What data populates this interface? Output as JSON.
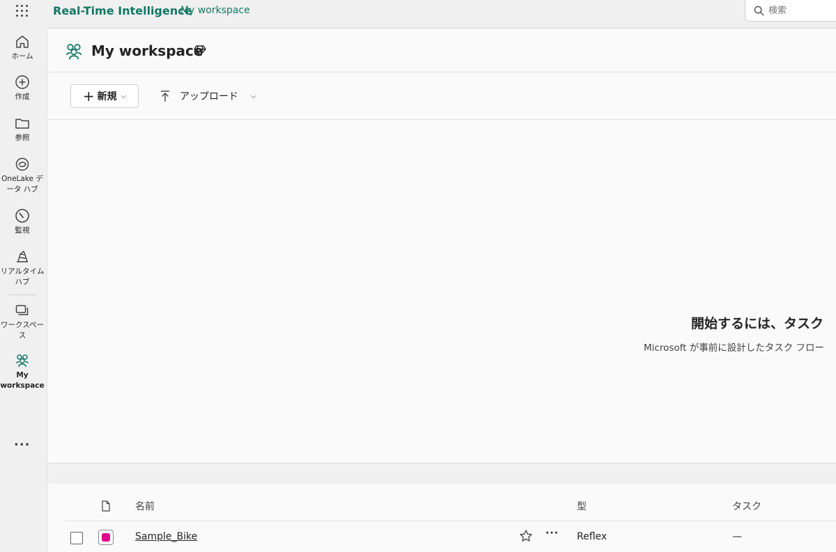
{
  "topbar": {
    "app_title": "Real-Time Intelligence",
    "breadcrumb": "My workspace",
    "search_placeholder": "検索"
  },
  "leftnav": {
    "items": [
      {
        "label": "ホーム",
        "icon": "home-icon"
      },
      {
        "label": "作成",
        "icon": "create-icon"
      },
      {
        "label": "参照",
        "icon": "folder-icon"
      },
      {
        "label": "OneLake データ ハブ",
        "icon": "onelake-icon"
      },
      {
        "label": "監視",
        "icon": "monitor-icon"
      },
      {
        "label": "リアルタイム ハブ",
        "icon": "realtime-hub-icon"
      },
      {
        "label": "ワークスペース",
        "icon": "workspaces-icon"
      },
      {
        "label": "My workspace",
        "icon": "my-workspace-icon"
      }
    ],
    "more_label": "..."
  },
  "workspace": {
    "title": "My workspace"
  },
  "toolbar": {
    "new_label": "新規",
    "upload_label": "アップロード"
  },
  "empty_state": {
    "title": "開始するには、タスク",
    "description": "Microsoft が事前に設計したタスク フロー"
  },
  "table": {
    "columns": [
      "名前",
      "型",
      "タスク"
    ],
    "rows": [
      {
        "name": "Sample_Bike",
        "type": "Reflex",
        "task": "—"
      }
    ]
  },
  "colors": {
    "accent": "#117865",
    "reflex": "#e3008c"
  }
}
